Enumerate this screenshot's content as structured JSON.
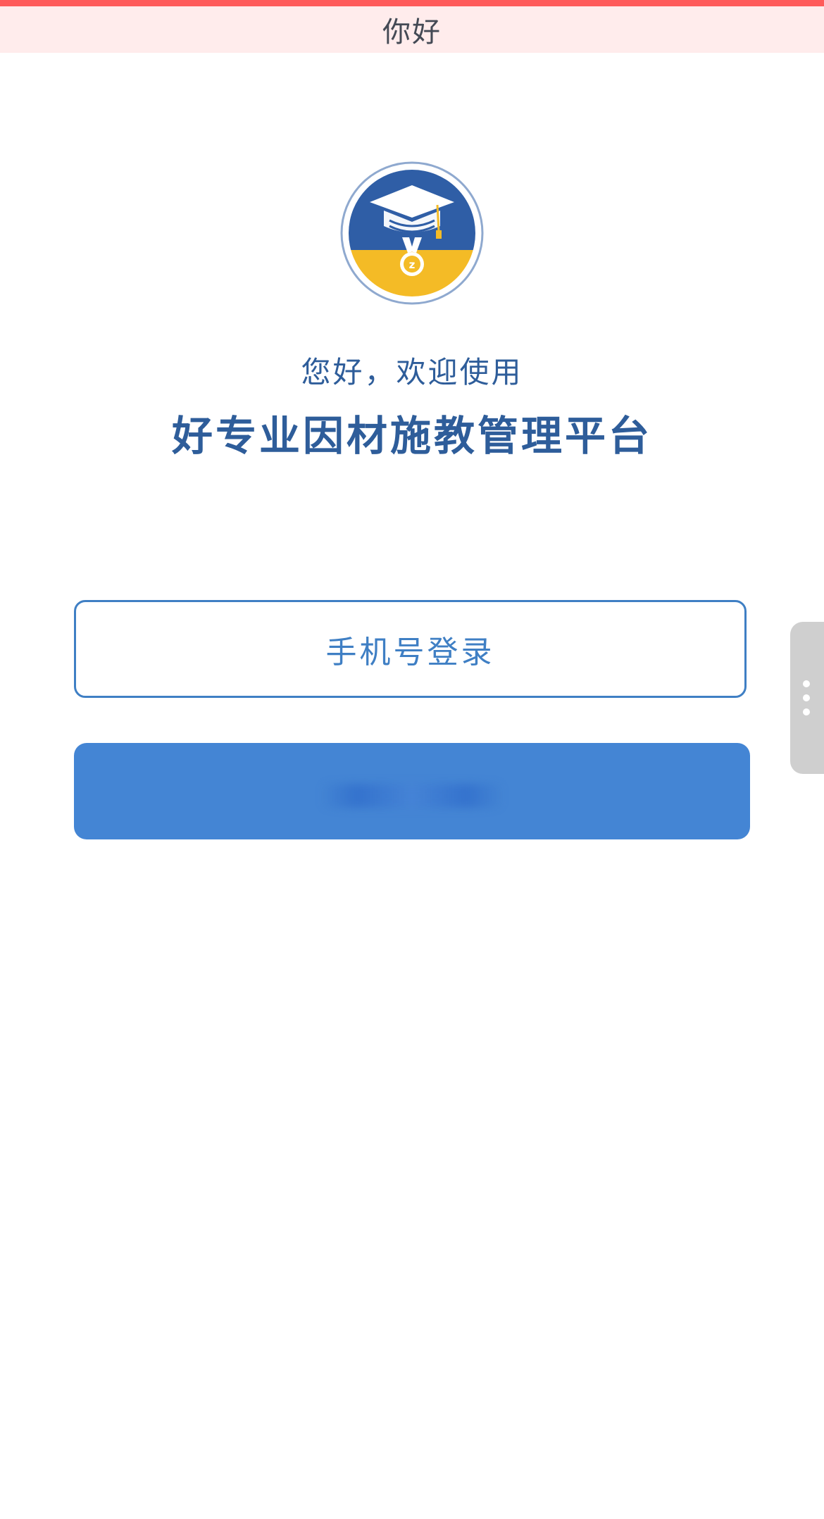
{
  "window": {
    "title": "你好"
  },
  "header": {
    "welcome": "您好，欢迎使用",
    "platform_name": "好专业因材施教管理平台"
  },
  "login": {
    "phone_label": "手机号登录"
  },
  "logo": {
    "icon": "graduation-cap-medal-logo",
    "colors": {
      "top": "#2f5ea6",
      "bottom": "#f4bb26",
      "ring": "#8fa9cf"
    }
  },
  "colors": {
    "accent": "#3f7fc4",
    "primary_button": "#4485d4",
    "top_strip": "#ff5a5a",
    "title_bar": "#ffecec"
  },
  "side_tab": {
    "icon": "more-vertical-icon"
  }
}
